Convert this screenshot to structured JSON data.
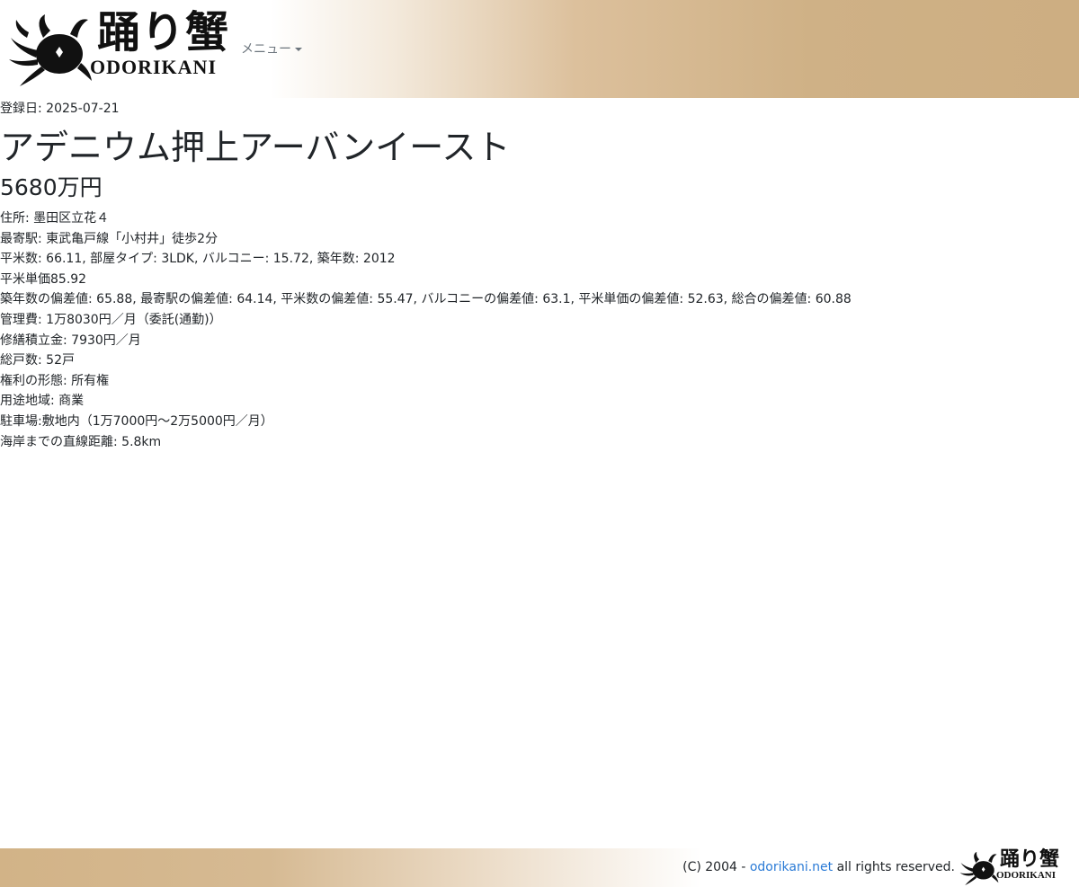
{
  "header": {
    "logo_jp": "踊り蟹",
    "logo_en": "ODORIKANI",
    "menu_label": "メニュー"
  },
  "listing": {
    "registered": "登録日: 2025-07-21",
    "title": "アデニウム押上アーバンイースト",
    "price": "5680万円",
    "details": [
      "住所: 墨田区立花４",
      "最寄駅: 東武亀戸線「小村井」徒歩2分",
      "平米数: 66.11, 部屋タイプ: 3LDK, バルコニー: 15.72, 築年数: 2012",
      "平米単価85.92",
      "築年数の偏差値: 65.88, 最寄駅の偏差値: 64.14, 平米数の偏差値: 55.47, バルコニーの偏差値: 63.1, 平米単価の偏差値: 52.63, 総合の偏差値: 60.88",
      "管理費: 1万8030円／月（委託(通勤)）",
      "修繕積立金: 7930円／月",
      "総戸数: 52戸",
      "権利の形態: 所有権",
      "用途地域: 商業",
      "駐車場:敷地内（1万7000円～2万5000円／月）",
      "海岸までの直線距離: 5.8km"
    ]
  },
  "footer": {
    "copyright_prefix": "(C) 2004 - ",
    "site_link": "odorikani.net",
    "copyright_suffix": " all rights reserved.",
    "logo_jp": "踊り蟹",
    "logo_en": "ODORIKANI"
  },
  "colors": {
    "header_gradient_end": "#cdae82",
    "footer_gradient_start": "#d2b387",
    "link": "#2b7bd6",
    "menu_text": "#6c757d"
  }
}
